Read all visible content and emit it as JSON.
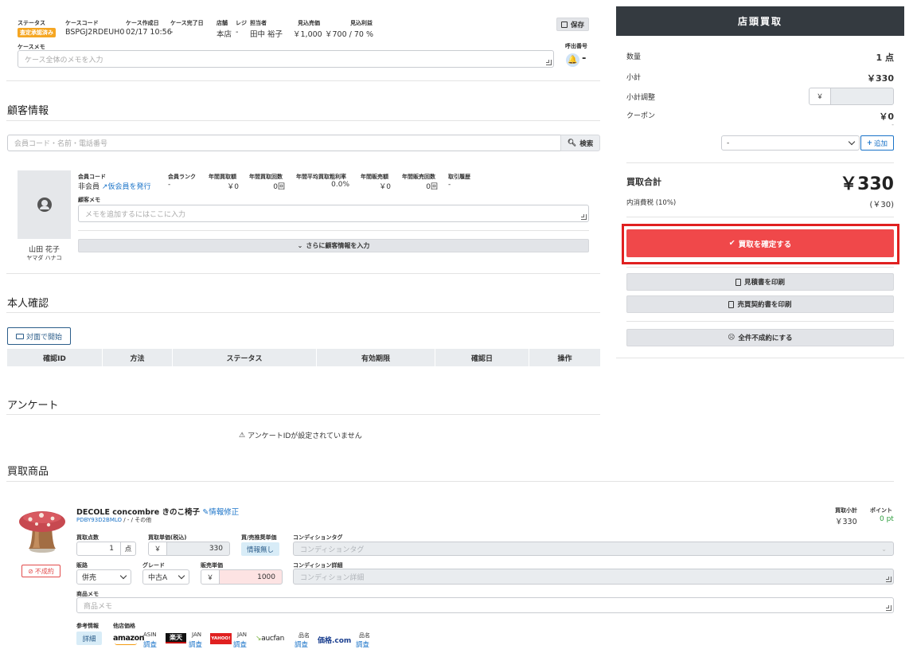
{
  "case": {
    "status_label": "ステータス",
    "status_badge": "査定承認済み",
    "code_label": "ケースコード",
    "code": "BSPGJ2RDEUH0",
    "created_label": "ケース作成日",
    "created": "02/17 10:56",
    "completed_label": "ケース完了日",
    "completed": "-",
    "store_label": "店舗",
    "store": "本店",
    "register_label": "レジ",
    "register": "-",
    "staff_label": "担当者",
    "staff": "田中 裕子",
    "est_sale_label": "見込売価",
    "est_sale": "￥1,000",
    "est_profit_label": "見込利益",
    "est_profit": "￥700 / 70 %",
    "save_label": "保存",
    "memo_label": "ケースメモ",
    "memo_placeholder": "ケース全体のメモを入力",
    "call_label": "呼出番号",
    "call_value": "-"
  },
  "customer": {
    "section_title": "顧客情報",
    "search_placeholder": "会員コード・名前・電話番号",
    "search_button": "検索",
    "name": "山田 花子",
    "kana": "ヤマダ ハナコ",
    "stats": [
      {
        "label": "会員コード",
        "value": "非会員",
        "link": "仮会員を発行"
      },
      {
        "label": "会員ランク",
        "value": "-"
      },
      {
        "label": "年間買取額",
        "value": "￥0"
      },
      {
        "label": "年間買取回数",
        "value": "0回"
      },
      {
        "label": "年間平均買取粗利率",
        "value": "0.0%"
      },
      {
        "label": "年間販売額",
        "value": "￥0"
      },
      {
        "label": "年間販売回数",
        "value": "0回"
      },
      {
        "label": "取引履歴",
        "value": "-"
      }
    ],
    "memo_label": "顧客メモ",
    "memo_placeholder": "メモを追加するにはここに入力",
    "more_button": "さらに顧客情報を入力"
  },
  "identity": {
    "section_title": "本人確認",
    "start_button": "対面で開始",
    "columns": [
      "確認ID",
      "方法",
      "ステータス",
      "有効期限",
      "確認日",
      "操作"
    ]
  },
  "survey": {
    "section_title": "アンケート",
    "empty_message": "アンケートIDが設定されていません"
  },
  "products": {
    "section_title": "買取商品",
    "item": {
      "name": "DECOLE concombre きのこ椅子",
      "edit_link": "情報修正",
      "code": "PDBY93D2BMLO",
      "code_suffix": " / - / その他",
      "reject_button": "不成約",
      "subtotal_label": "買取小計",
      "subtotal": "￥330",
      "points_label": "ポイント",
      "points": "0 pt",
      "qty_label": "買取点数",
      "qty": "1",
      "qty_unit": "点",
      "unit_price_label": "買取単価(税込)",
      "yen": "￥",
      "unit_price": "330",
      "recommend_label": "買/売推奨単価",
      "recommend": "情報無し",
      "cond_tag_label": "コンディションタグ",
      "cond_tag_placeholder": "コンディションタグ",
      "channel_label": "販路",
      "channel": "併売",
      "grade_label": "グレード",
      "grade": "中古A",
      "sale_price_label": "販売単価",
      "sale_price": "1000",
      "cond_detail_label": "コンディション詳細",
      "cond_detail_placeholder": "コンディション詳細",
      "memo_label": "商品メモ",
      "memo_placeholder": "商品メモ",
      "ref_label": "参考情報",
      "ref_button": "詳細",
      "other_label": "他店価格",
      "shops": [
        {
          "logo": "amazon",
          "key": "ASIN",
          "action": "調査"
        },
        {
          "logo": "楽天",
          "key": "JAN",
          "action": "調査"
        },
        {
          "logo": "YAHOO!",
          "key": "JAN",
          "action": "調査"
        },
        {
          "logo": "aucfan",
          "key": "品名",
          "action": "調査"
        },
        {
          "logo": "価格.com",
          "key": "品名",
          "action": "調査"
        }
      ]
    }
  },
  "summary": {
    "title": "店頭買取",
    "qty_label": "数量",
    "qty": "1 点",
    "subtotal_label": "小計",
    "subtotal": "￥330",
    "adjust_label": "小計調整",
    "adjust_prefix": "￥",
    "coupon_label": "クーポン",
    "coupon": "￥0",
    "coupon_dash": "-",
    "coupon_select": "-",
    "add_button": "追加",
    "total_label": "買取合計",
    "total": "￥330",
    "tax_label": "内消費税 (10%)",
    "tax": "(￥30)",
    "confirm_button": "買取を確定する",
    "print_estimate": "見積書を印刷",
    "print_contract": "売買契約書を印刷",
    "reject_all": "全件不成約にする"
  },
  "colors": {
    "confirm": "#f0484a",
    "highlight_border": "#e02020",
    "header_dark": "#343a40",
    "badge": "#f5a623",
    "link": "#1a73c8"
  }
}
